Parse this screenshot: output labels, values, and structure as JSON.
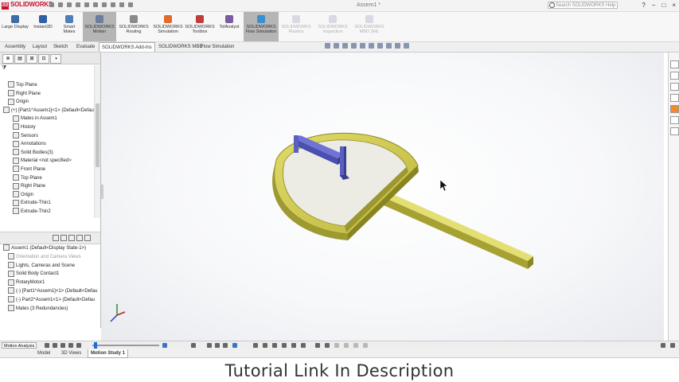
{
  "app": {
    "logo_text": "SOLIDWORKS",
    "document_title": "Assem1 *",
    "search_placeholder": "Search SOLIDWORKS Help",
    "window_controls": [
      "?",
      "−",
      "□",
      "×"
    ]
  },
  "ribbon": {
    "buttons": [
      {
        "label": "Large Display",
        "state": "normal",
        "color": "#3a6ea5"
      },
      {
        "label": "Instant3D",
        "state": "normal",
        "color": "#2f5fa7"
      },
      {
        "label": "Smart Mates",
        "state": "normal",
        "color": "#4f7fb8"
      },
      {
        "label": "SOLIDWORKS Motion",
        "state": "active",
        "color": "#6a7e9c"
      },
      {
        "label": "SOLIDWORKS Routing",
        "state": "normal",
        "color": "#8a8a8a"
      },
      {
        "label": "SOLIDWORKS Simulation",
        "state": "normal",
        "color": "#e06b2b"
      },
      {
        "label": "SOLIDWORKS Toolbox",
        "state": "normal",
        "color": "#c33c3c"
      },
      {
        "label": "TolAnalyst",
        "state": "normal",
        "color": "#7a5aa0"
      },
      {
        "label": "SOLIDWORKS Flow Simulation",
        "state": "active",
        "color": "#3a8fcf"
      },
      {
        "label": "SOLIDWORKS Plastics",
        "state": "disabled",
        "color": "#9aa7b8"
      },
      {
        "label": "SOLIDWORKS Inspection",
        "state": "disabled",
        "color": "#9aa7b8"
      },
      {
        "label": "SOLIDWORKS MBD SNL",
        "state": "disabled",
        "color": "#9aa7b8"
      }
    ]
  },
  "command_tabs": [
    "Assembly",
    "Layout",
    "Sketch",
    "Evaluate",
    "SOLIDWORKS Add-Ins",
    "SOLIDWORKS MBD",
    "Flow Simulation"
  ],
  "command_tabs_selected": 4,
  "feature_tree": {
    "items": [
      {
        "label": "Top Plane",
        "indent": 1
      },
      {
        "label": "Right Plane",
        "indent": 1
      },
      {
        "label": "Origin",
        "indent": 1
      },
      {
        "label": "(+) [Part1^Assem1]<1> (Default<Defau",
        "indent": 0,
        "expand": true
      },
      {
        "label": "Mates in Assem1",
        "indent": 2
      },
      {
        "label": "History",
        "indent": 2
      },
      {
        "label": "Sensors",
        "indent": 2
      },
      {
        "label": "Annotations",
        "indent": 2
      },
      {
        "label": "Solid Bodies(3)",
        "indent": 2
      },
      {
        "label": "Material <not specified>",
        "indent": 2
      },
      {
        "label": "Front Plane",
        "indent": 2
      },
      {
        "label": "Top Plane",
        "indent": 2
      },
      {
        "label": "Right Plane",
        "indent": 2
      },
      {
        "label": "Origin",
        "indent": 2
      },
      {
        "label": "Extrude-Thin1",
        "indent": 2
      },
      {
        "label": "Extrude-Thin2",
        "indent": 2
      }
    ]
  },
  "motion_tree": {
    "items": [
      {
        "label": "Assem1 (Default<Display State-1>)",
        "indent": 0
      },
      {
        "label": "Orientation and Camera Views",
        "indent": 1,
        "dim": true
      },
      {
        "label": "Lights, Cameras and Scene",
        "indent": 1
      },
      {
        "label": "Solid Body Contact1",
        "indent": 1
      },
      {
        "label": "RotaryMotor1",
        "indent": 1
      },
      {
        "label": "(-) [Part1^Assem1]<1> (Default<Defau",
        "indent": 1
      },
      {
        "label": "(-) Part2^Assem1<1> (Default<Defau",
        "indent": 1
      },
      {
        "label": "Mates (3 Redundancies)",
        "indent": 1
      }
    ]
  },
  "motion_toolbar": {
    "study_type": "Motion Analysis"
  },
  "bottom_tabs": [
    "Model",
    "3D Views",
    "Motion Study 1"
  ],
  "bottom_tabs_selected": 2,
  "caption": "Tutorial Link In Description",
  "colors": {
    "part_yellow": "#d2cc4e",
    "part_dark": "#8e8a23",
    "link_blue": "#5a5fc2",
    "link_dark": "#3b3f8e"
  }
}
